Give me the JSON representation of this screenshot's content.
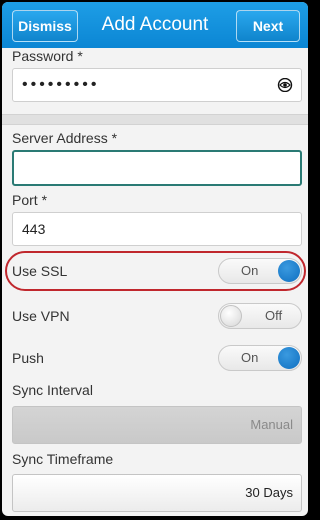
{
  "header": {
    "title": "Add Account",
    "dismiss_label": "Dismiss",
    "next_label": "Next"
  },
  "password": {
    "label": "Password *",
    "value": "•••••••••"
  },
  "server_address": {
    "label": "Server Address *",
    "value": ""
  },
  "port": {
    "label": "Port *",
    "value": "443"
  },
  "use_ssl": {
    "label": "Use SSL",
    "state": "On"
  },
  "use_vpn": {
    "label": "Use VPN",
    "state": "Off"
  },
  "push": {
    "label": "Push",
    "state": "On"
  },
  "sync_interval": {
    "label": "Sync Interval",
    "value": "Manual"
  },
  "sync_timeframe": {
    "label": "Sync Timeframe",
    "value": "30 Days"
  },
  "colors": {
    "accent": "#0b86d4",
    "highlight": "#c0272d",
    "focus_border": "#2a7a74"
  },
  "icons": {
    "reveal_password": "eye-icon"
  }
}
